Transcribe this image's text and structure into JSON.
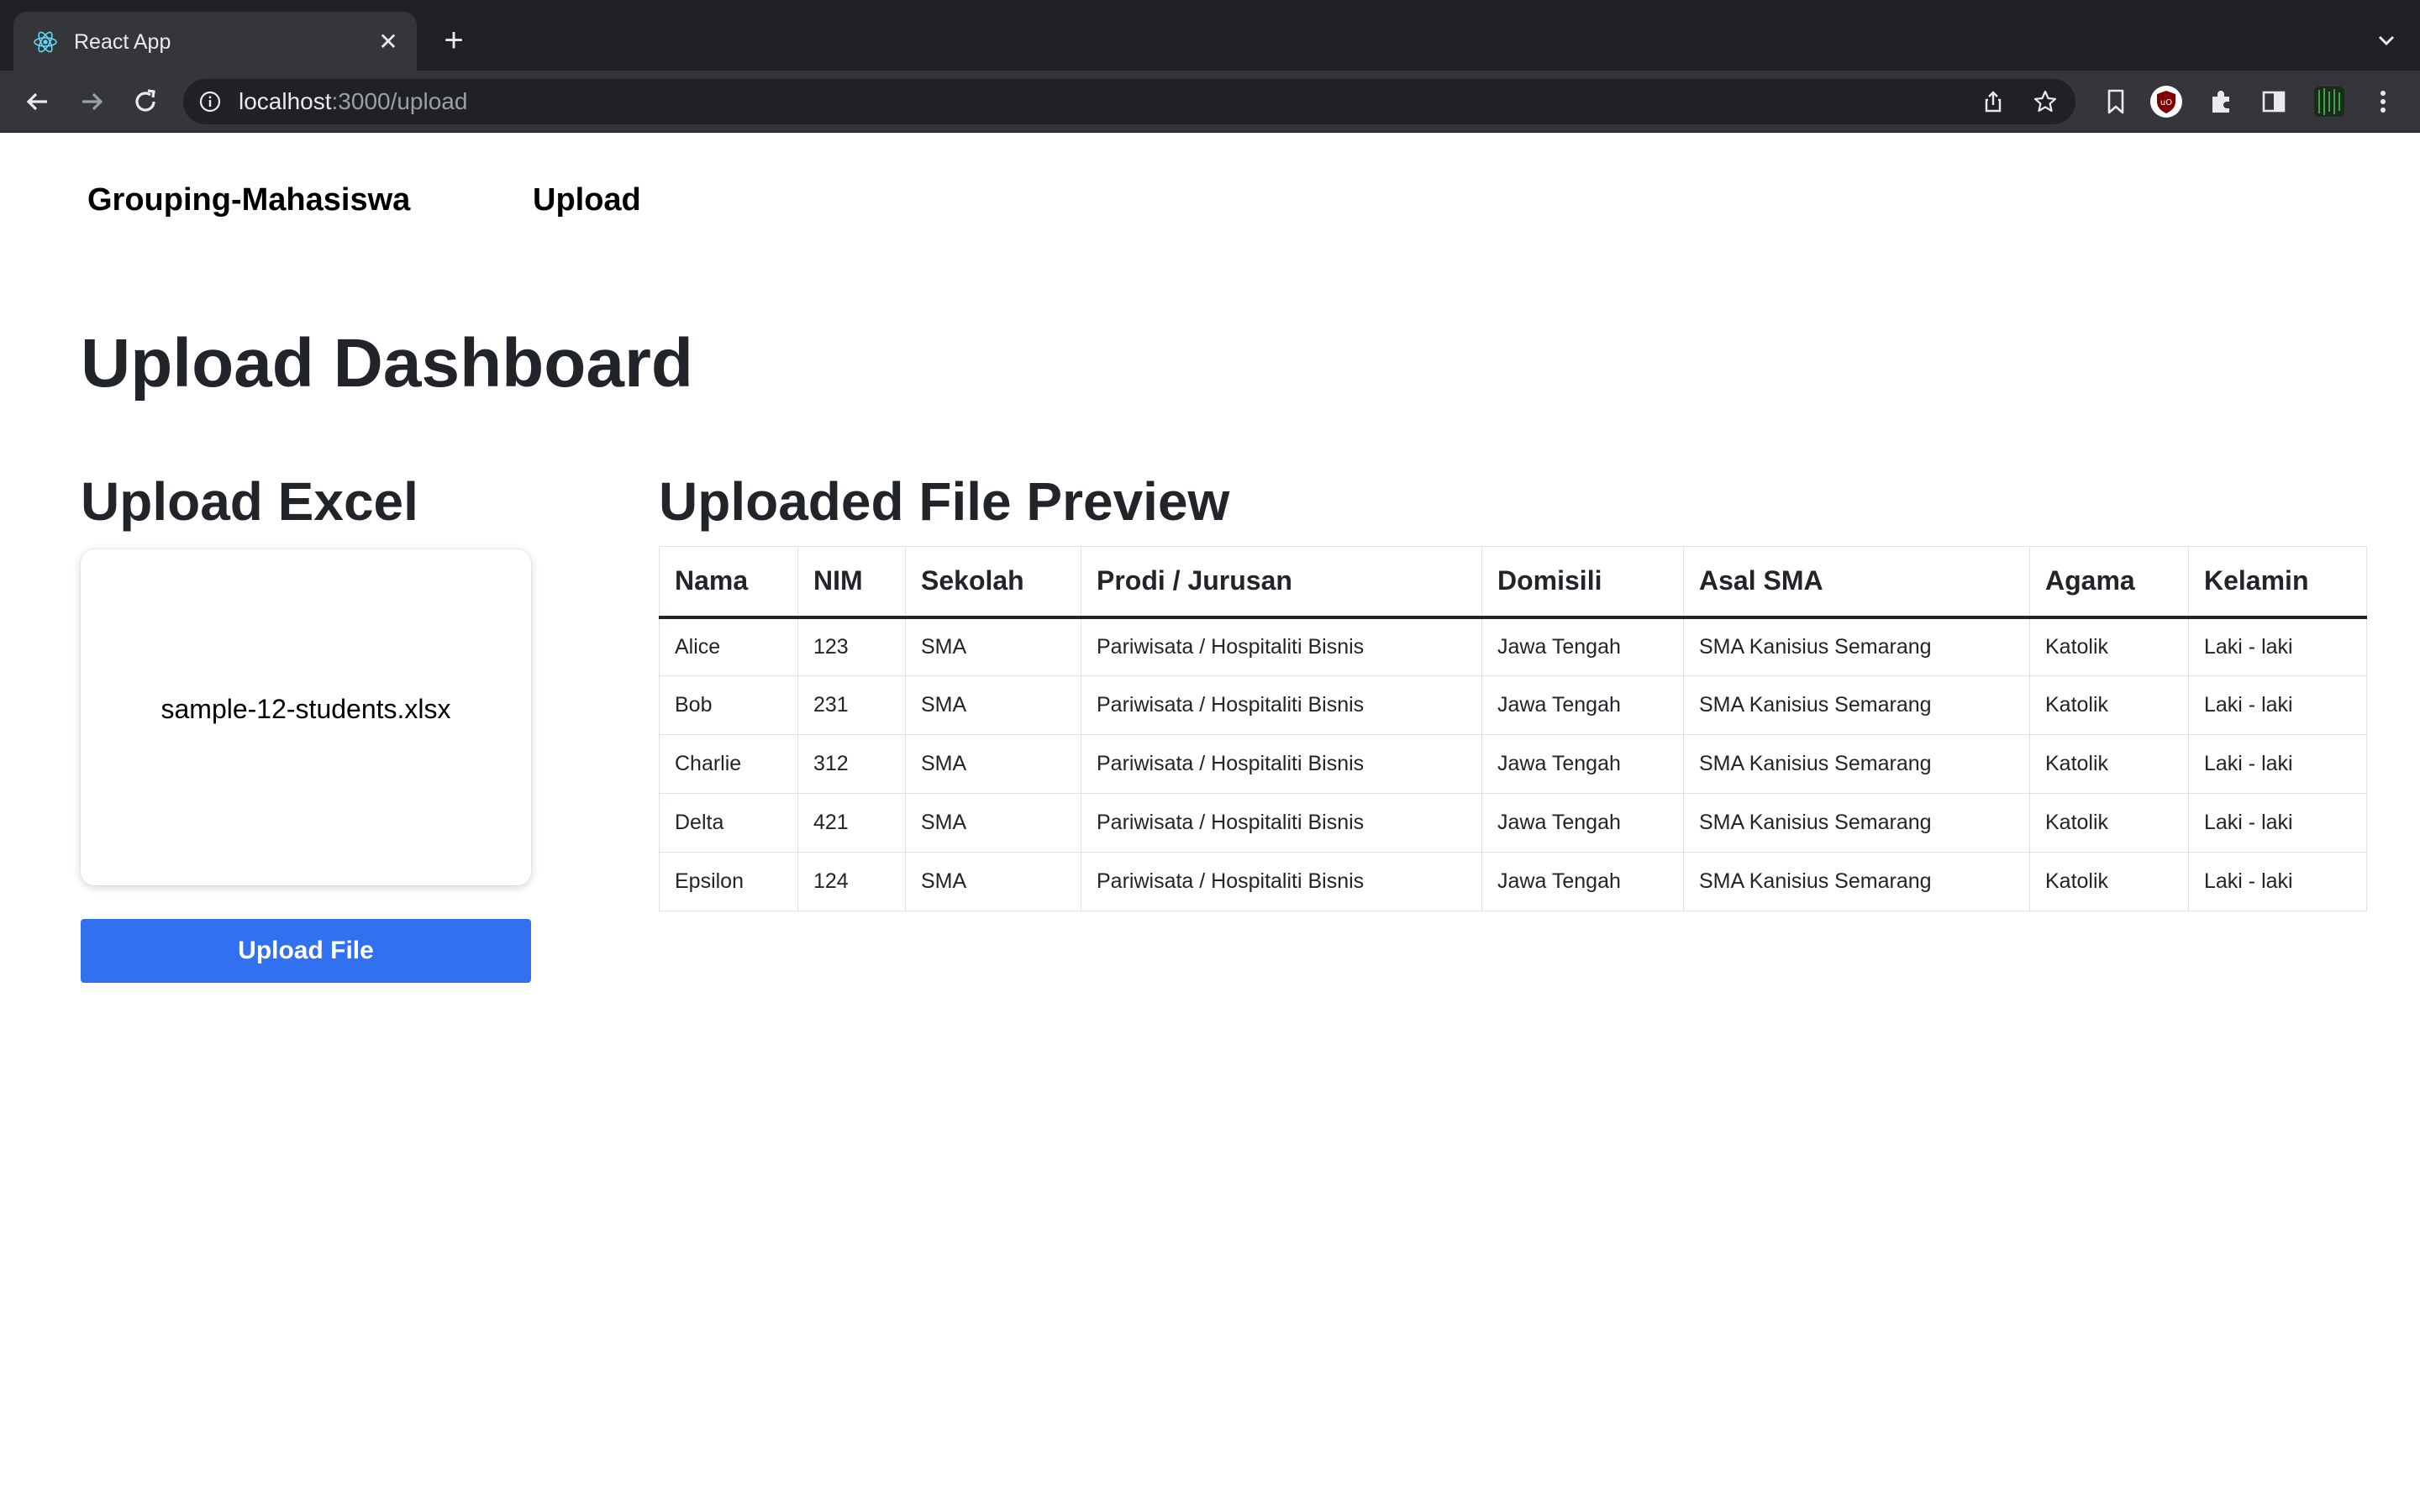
{
  "browser": {
    "tab_title": "React App",
    "url_host": "localhost",
    "url_path": ":3000/upload"
  },
  "navbar": {
    "brand": "Grouping-Mahasiswa",
    "link": "Upload"
  },
  "page": {
    "title": "Upload Dashboard",
    "upload_section_title": "Upload Excel",
    "preview_section_title": "Uploaded File Preview",
    "file_name": "sample-12-students.xlsx",
    "upload_button": "Upload File"
  },
  "table": {
    "columns": [
      "Nama",
      "NIM",
      "Sekolah",
      "Prodi / Jurusan",
      "Domisili",
      "Asal SMA",
      "Agama",
      "Kelamin"
    ],
    "rows": [
      [
        "Alice",
        "123",
        "SMA",
        "Pariwisata / Hospitaliti Bisnis",
        "Jawa Tengah",
        "SMA Kanisius Semarang",
        "Katolik",
        "Laki - laki"
      ],
      [
        "Bob",
        "231",
        "SMA",
        "Pariwisata / Hospitaliti Bisnis",
        "Jawa Tengah",
        "SMA Kanisius Semarang",
        "Katolik",
        "Laki - laki"
      ],
      [
        "Charlie",
        "312",
        "SMA",
        "Pariwisata / Hospitaliti Bisnis",
        "Jawa Tengah",
        "SMA Kanisius Semarang",
        "Katolik",
        "Laki - laki"
      ],
      [
        "Delta",
        "421",
        "SMA",
        "Pariwisata / Hospitaliti Bisnis",
        "Jawa Tengah",
        "SMA Kanisius Semarang",
        "Katolik",
        "Laki - laki"
      ],
      [
        "Epsilon",
        "124",
        "SMA",
        "Pariwisata / Hospitaliti Bisnis",
        "Jawa Tengah",
        "SMA Kanisius Semarang",
        "Katolik",
        "Laki - laki"
      ]
    ]
  },
  "colors": {
    "button": "#3170ef",
    "chrome_dark": "#202124",
    "chrome_tab": "#35363a"
  }
}
